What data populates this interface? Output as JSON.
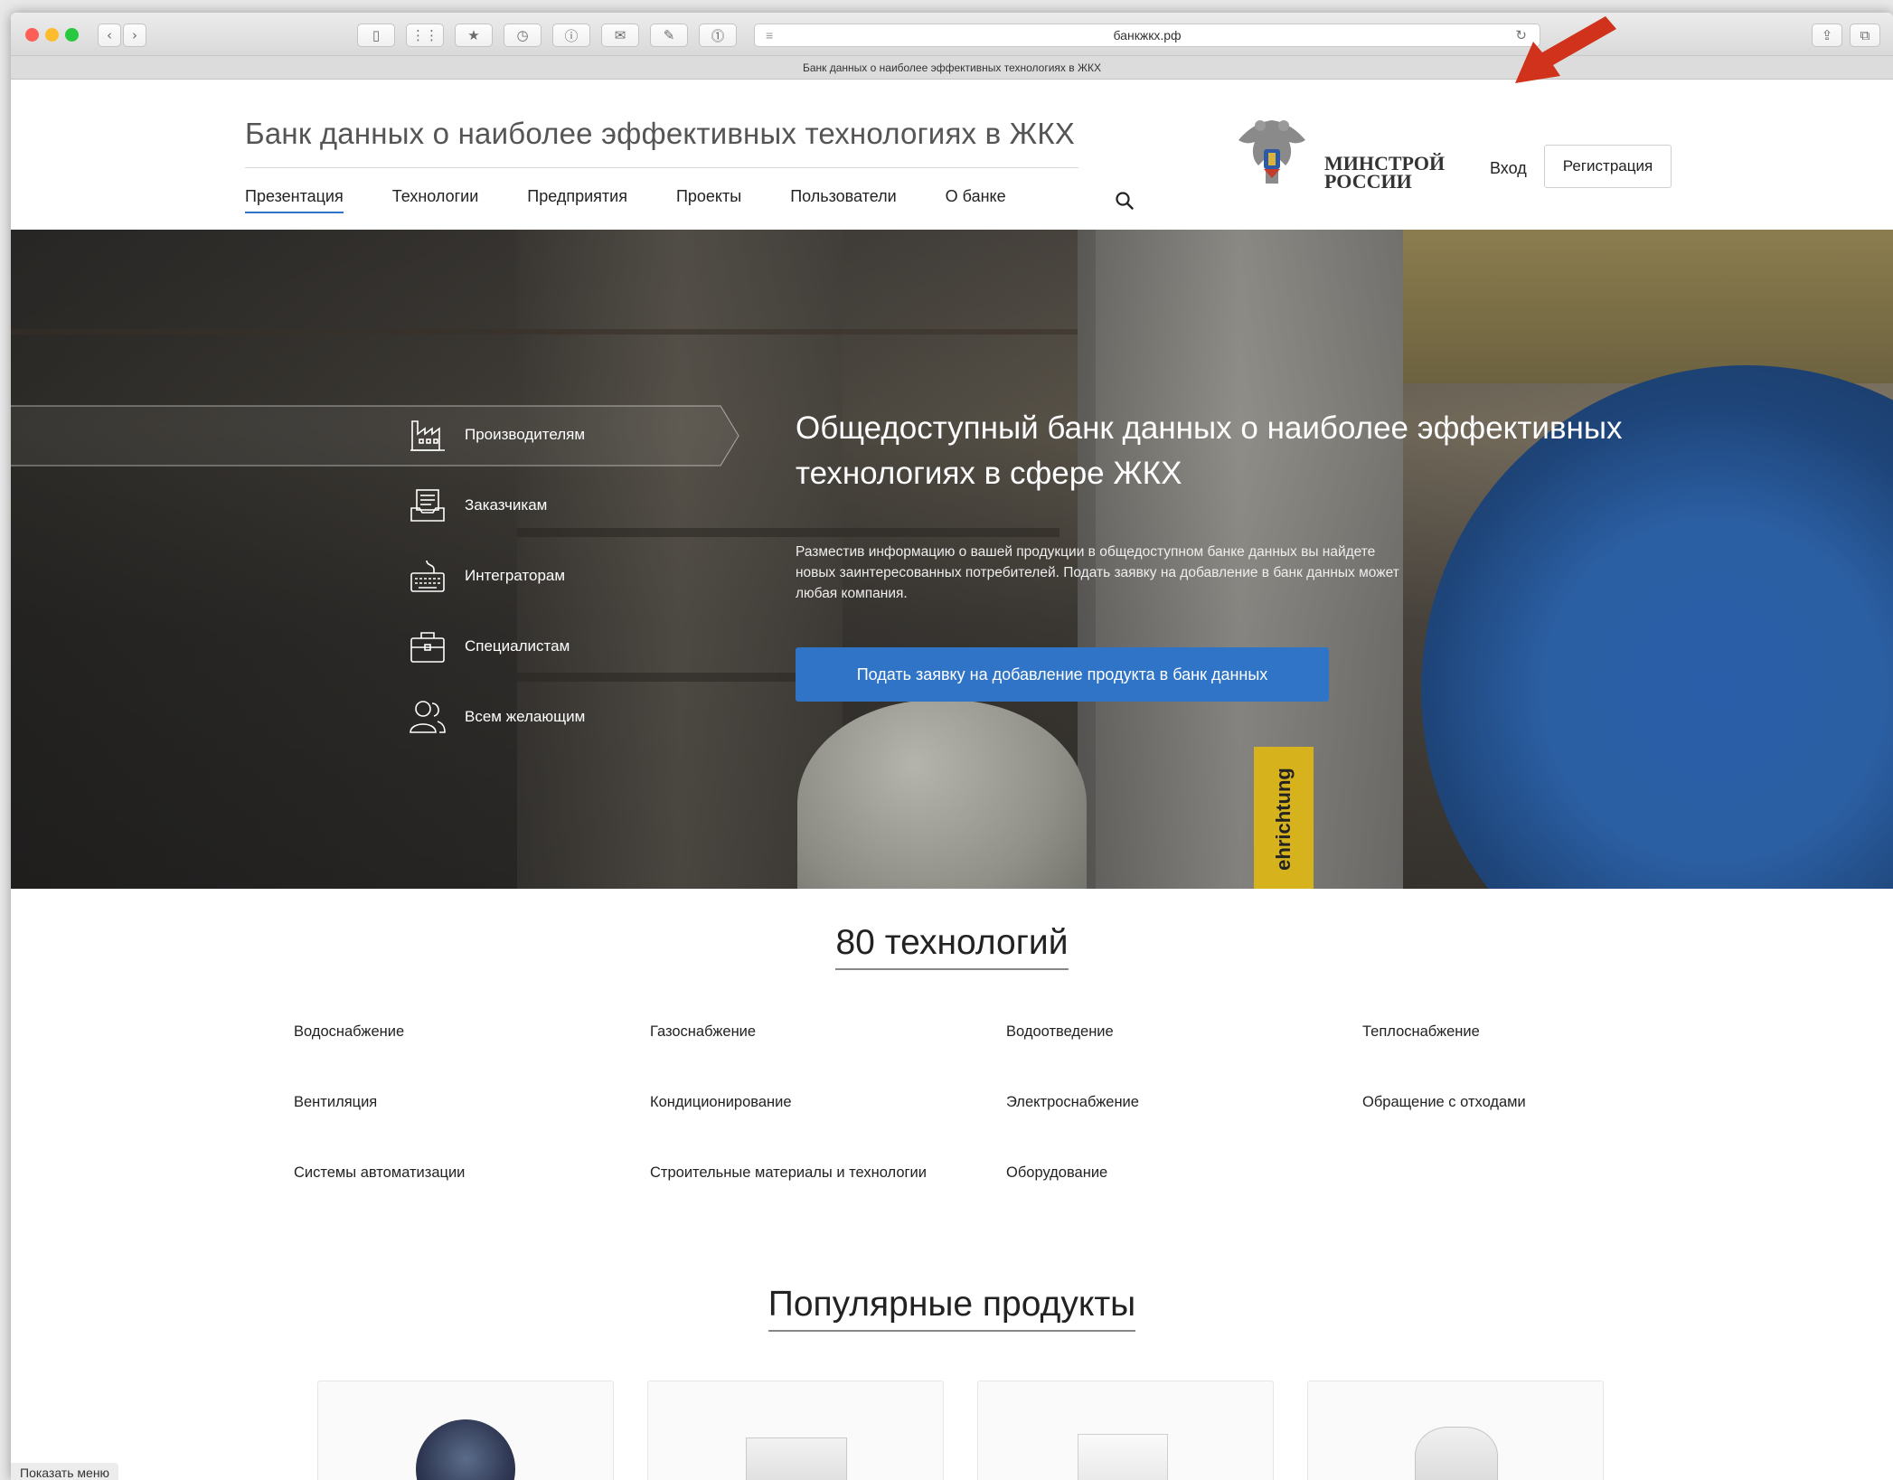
{
  "browser": {
    "url": "банкжкх.рф",
    "tab_title": "Банк данных о наиболее эффективных технологиях в ЖКХ"
  },
  "header": {
    "site_title": "Банк данных о наиболее эффективных технологиях в ЖКХ",
    "nav": [
      {
        "label": "Презентация",
        "active": true
      },
      {
        "label": "Технологии"
      },
      {
        "label": "Предприятия"
      },
      {
        "label": "Проекты"
      },
      {
        "label": "Пользователи"
      },
      {
        "label": "О банке"
      }
    ],
    "ministry_line1": "МИНСТРОЙ",
    "ministry_line2": "РОССИИ",
    "login": "Вход",
    "register": "Регистрация"
  },
  "hero": {
    "menu": [
      {
        "label": "Производителям",
        "icon": "factory-icon"
      },
      {
        "label": "Заказчикам",
        "icon": "document-tray-icon"
      },
      {
        "label": "Интеграторам",
        "icon": "keyboard-icon"
      },
      {
        "label": "Специалистам",
        "icon": "briefcase-icon"
      },
      {
        "label": "Всем желающим",
        "icon": "users-icon"
      }
    ],
    "title": "Общедоступный банк данных о наиболее эффективных технологиях в сфере ЖКХ",
    "text": "Разместив информацию о вашей продукции в общедоступном банке данных вы найдете новых заинтересованных потребителей. Подать заявку на добавление в банк данных может любая компания.",
    "button": "Подать заявку на добавление продукта в банк данных",
    "label_sign": "ehrichtung"
  },
  "technologies": {
    "heading": "80 технологий",
    "items": [
      "Водоснабжение",
      "Газоснабжение",
      "Водоотведение",
      "Теплоснабжение",
      "Вентиляция",
      "Кондиционирование",
      "Электроснабжение",
      "Обращение с отходами",
      "Системы автоматизации",
      "Строительные материалы и технологии",
      "Оборудование"
    ]
  },
  "popular": {
    "heading": "Популярные продукты"
  },
  "footer": {
    "show_menu": "Показать меню"
  },
  "colors": {
    "accent": "#2f74c6",
    "arrow": "#d0321c"
  }
}
